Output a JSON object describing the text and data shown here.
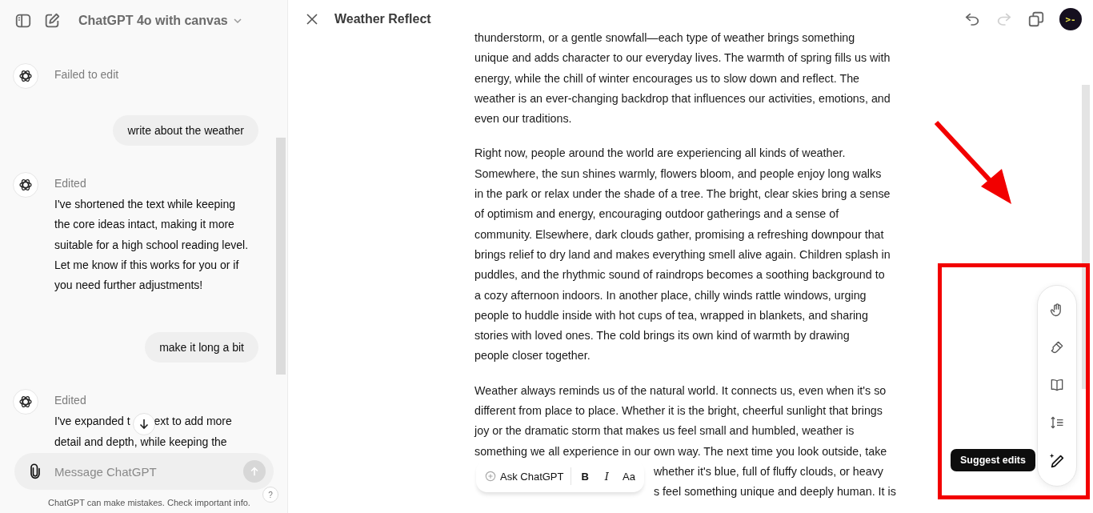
{
  "sidebar": {
    "title": "ChatGPT 4o with canvas",
    "messages": [
      {
        "kind": "assistant",
        "status": "Failed to edit"
      },
      {
        "kind": "user",
        "text": "write about the weather"
      },
      {
        "kind": "assistant",
        "status": "Edited",
        "lines": [
          [
            "I've shortened the text while keeping"
          ],
          [
            "the core ideas intact, making it more"
          ],
          [
            "suitable for a high school reading level."
          ],
          [
            "Let me know if this works for you or if"
          ],
          [
            "you need further adjustments!"
          ]
        ]
      },
      {
        "kind": "user",
        "text": "make it long a bit"
      },
      {
        "kind": "assistant",
        "status": "Edited",
        "lines": [
          [
            "I've expanded t",
            "ext to add more"
          ],
          [
            "detail and depth, while keeping the"
          ]
        ]
      }
    ],
    "composer": {
      "placeholder": "Message ChatGPT"
    },
    "disclaimer": "ChatGPT can make mistakes. Check important info.",
    "help": "?"
  },
  "canvas": {
    "title": "Weather Reflect",
    "avatar": ">-",
    "actions": [
      {
        "kind": "undo",
        "disabled": false
      },
      {
        "kind": "redo",
        "disabled": true
      },
      {
        "kind": "copy",
        "disabled": false
      }
    ],
    "paragraphs": [
      {
        "lines": [
          "thunderstorm, or a gentle snowfall—each type of weather brings something",
          "unique and adds character to our everyday lives. The warmth of spring fills us with",
          "energy, while the chill of winter encourages us to slow down and reflect. The",
          "weather is an ever-changing backdrop that influences our activities, emotions, and",
          "even our traditions."
        ]
      },
      {
        "lines": [
          "Right now, people around the world are experiencing all kinds of weather.",
          "Somewhere, the sun shines warmly, flowers bloom, and people enjoy long walks",
          "in the park or relax under the shade of a tree. The bright, clear skies bring a sense",
          "of optimism and energy, encouraging outdoor gatherings and a sense of",
          "community. Elsewhere, dark clouds gather, promising a refreshing downpour that",
          "brings relief to dry land and makes everything smell alive again. Children splash in",
          "puddles, and the rhythmic sound of raindrops becomes a soothing background to",
          "a cozy afternoon indoors. In another place, chilly winds rattle windows, urging",
          "people to huddle inside with hot cups of tea, wrapped in blankets, and sharing",
          "stories with loved ones. The cold brings its own kind of warmth by drawing",
          "people closer together."
        ]
      },
      {
        "lines": [
          "Weather always reminds us of the natural world. It connects us, even when it's so",
          "different from place to place. Whether it is the bright, cheerful sunlight that brings",
          "joy or the dramatic storm that makes us feel small and humbled, weather is",
          "something we all experience in our own way. The next time you look outside, take"
        ],
        "covered_lines": [
          "whether it's blue, full of fluffy clouds, or heavy",
          "s feel something unique and deeply human. It is"
        ]
      }
    ],
    "format_bar": {
      "ask": "Ask ChatGPT",
      "bold": "B",
      "italic": "I",
      "size": "Aa"
    },
    "tools": [
      {
        "kind": "hand"
      },
      {
        "kind": "brush"
      },
      {
        "kind": "book"
      },
      {
        "kind": "length"
      },
      {
        "kind": "suggest",
        "tooltip": "Suggest edits"
      }
    ]
  }
}
